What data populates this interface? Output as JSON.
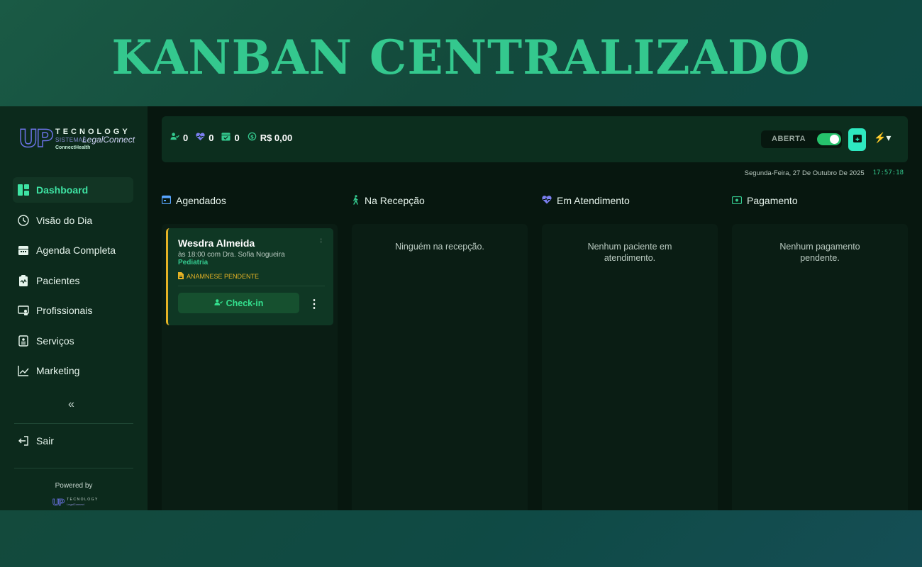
{
  "banner": {
    "title": "KANBAN CENTRALIZADO"
  },
  "brand": {
    "logo_up": "UP",
    "logo_tecnology": "TECNOLOGY",
    "logo_sistemas": "SISTEMAS",
    "logo_legalconnect": "LegalConnect",
    "logo_connecthealth": "ConnectHealth",
    "powered_by": "Powered by"
  },
  "sidebar": {
    "items": [
      {
        "label": "Dashboard",
        "icon": "dashboard-icon",
        "active": true
      },
      {
        "label": "Visão do Dia",
        "icon": "clock-icon"
      },
      {
        "label": "Agenda Completa",
        "icon": "calendar-icon"
      },
      {
        "label": "Pacientes",
        "icon": "clipboard-icon"
      },
      {
        "label": "Profissionais",
        "icon": "monitor-user-icon"
      },
      {
        "label": "Serviços",
        "icon": "list-icon"
      },
      {
        "label": "Marketing",
        "icon": "trend-icon"
      }
    ],
    "collapse_glyph": "«",
    "logout_label": "Sair"
  },
  "topbar": {
    "stats": [
      {
        "icon": "user-check-icon",
        "value": "0",
        "color": "#34c88e"
      },
      {
        "icon": "heart-pulse-icon",
        "value": "0",
        "color": "#7b7ff0"
      },
      {
        "icon": "calendar-check-icon",
        "value": "0",
        "color": "#34c88e"
      },
      {
        "icon": "money-icon",
        "value": "R$ 0,00",
        "color": "#34c88e"
      }
    ],
    "status_label": "ABERTA",
    "status_on": true,
    "bolt_glyph": "⚡▾"
  },
  "datetime": {
    "date": "Segunda-Feira, 27 De Outubro De 2025",
    "time": "17:57:18"
  },
  "columns": [
    {
      "title": "Agendados",
      "icon": "calendar-icon",
      "empty": ""
    },
    {
      "title": "Na Recepção",
      "icon": "walking-icon",
      "empty": "Ninguém na recepção."
    },
    {
      "title": "Em Atendimento",
      "icon": "heart-pulse-icon",
      "empty": "Nenhum paciente em atendimento."
    },
    {
      "title": "Pagamento",
      "icon": "money-icon",
      "empty": "Nenhum pagamento pendente."
    }
  ],
  "card": {
    "patient": "Wesdra Almeida",
    "time_line": "às 18:00 com Dra. Sofia Nogueira",
    "specialty": "Pediatria",
    "warning": "ANAMNESE PENDENTE",
    "checkin_label": "Check-in",
    "menu_glyph": "⋮"
  },
  "colors": {
    "accent": "#34c88e",
    "warning": "#e6b325",
    "purple": "#7b7ff0"
  }
}
